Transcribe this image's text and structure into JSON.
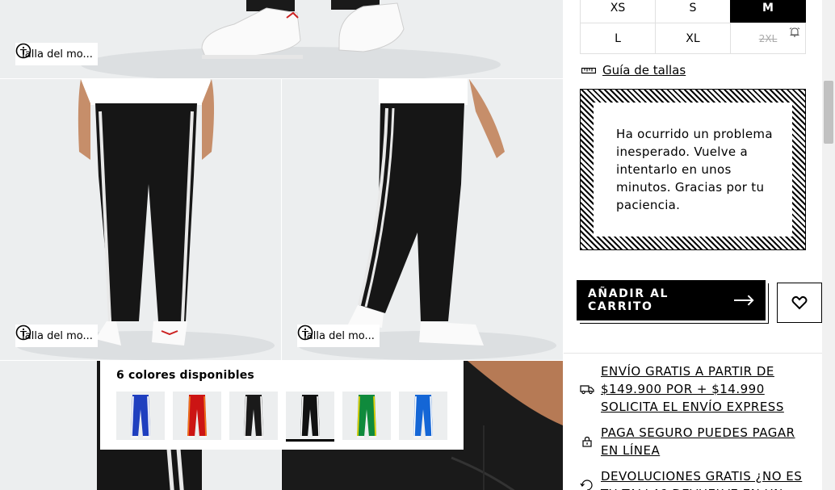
{
  "gallery": {
    "size_chip_label": "Talla del mo...",
    "colors_title": "6 colores disponibles",
    "swatches": [
      {
        "name": "royal-blue",
        "color": "#1f3fbf",
        "stripe": "#ffffff",
        "active": false
      },
      {
        "name": "red",
        "color": "#cc1414",
        "stripe": "#f07a1a",
        "active": false
      },
      {
        "name": "black-1",
        "color": "#1a1a1a",
        "stripe": "#ffffff",
        "active": false
      },
      {
        "name": "black-2",
        "color": "#111111",
        "stripe": "#ffffff",
        "active": true
      },
      {
        "name": "green",
        "color": "#0f8a3c",
        "stripe": "#f2d400",
        "active": false
      },
      {
        "name": "blue",
        "color": "#1466d6",
        "stripe": "#ffffff",
        "active": false
      }
    ]
  },
  "sizes": {
    "row1": [
      "XS",
      "S",
      "M"
    ],
    "row2": [
      "L",
      "XL",
      "2XL"
    ],
    "selected": "M",
    "unavailable": "2XL"
  },
  "size_guide": "Guía de tallas",
  "error_message": "Ha ocurrido un problema inesperado. Vuelve a intentarlo en unos minutos. Gracias por tu paciencia.",
  "cart_button": "AÑADIR AL CARRITO",
  "benefits": {
    "shipping": "ENVÍO GRATIS A PARTIR DE $149.900 POR + $14.990 SOLICITA EL ENVÍO EXPRESS",
    "payment": "PAGA SEGURO PUEDES PAGAR EN LÍNEA",
    "returns": "DEVOLUCIONES GRATIS ¿NO ES TU TALLA? DEVUELVE EN UN"
  },
  "colors": {
    "selected_bg": "#000000",
    "tile_bg": "#eceeef"
  }
}
